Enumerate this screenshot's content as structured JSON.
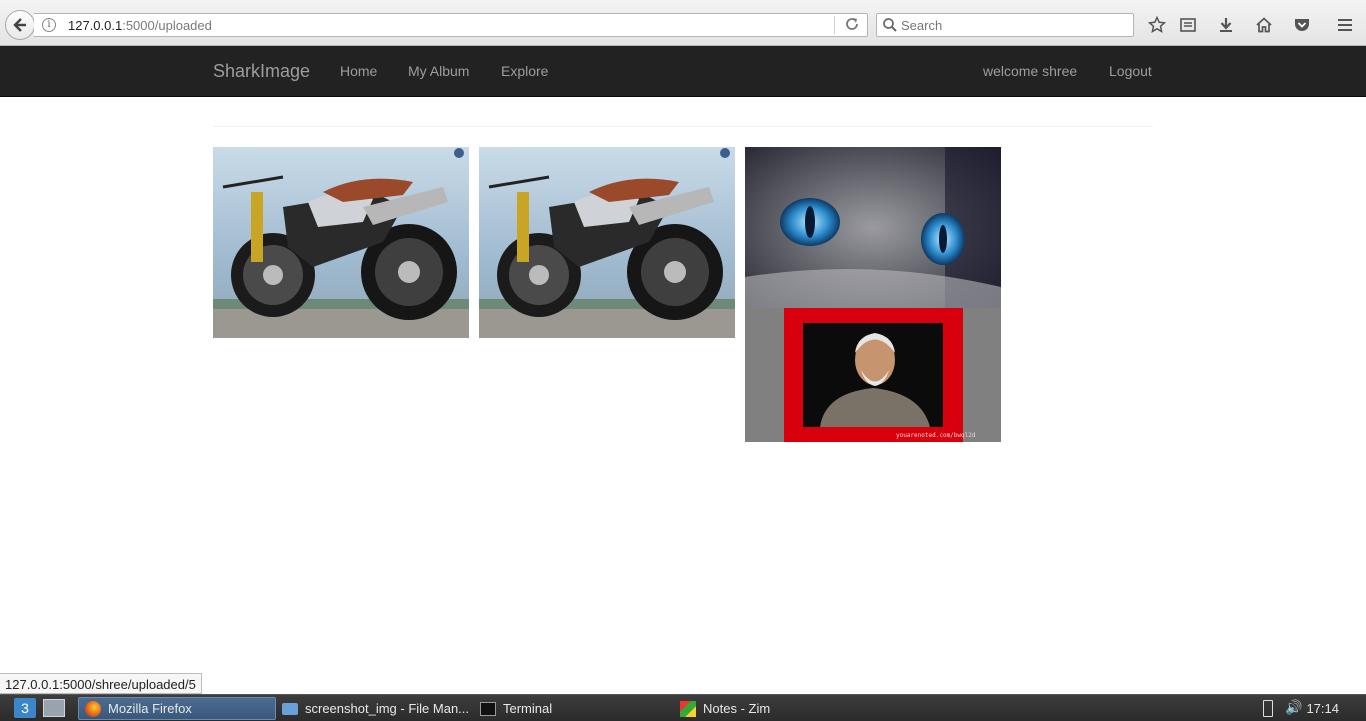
{
  "browser": {
    "url_host": "127.0.0.1",
    "url_path": ":5000/uploaded",
    "search_placeholder": "Search",
    "status_url": "127.0.0.1:5000/shree/uploaded/5"
  },
  "navbar": {
    "brand": "SharkImage",
    "links": [
      "Home",
      "My Album",
      "Explore"
    ],
    "welcome": "welcome shree",
    "logout": "Logout"
  },
  "gallery": {
    "images": [
      {
        "name": "motorcycle-photo-1"
      },
      {
        "name": "motorcycle-photo-2"
      },
      {
        "name": "cat-eyes-photo"
      },
      {
        "name": "portrait-photo",
        "caption": "youarenoted.com/bwql2d"
      }
    ]
  },
  "taskbar": {
    "tasks": [
      "Mozilla Firefox",
      "screenshot_img - File Man...",
      "Terminal",
      "Notes - Zim"
    ],
    "clock": "17:14"
  },
  "colors": {
    "navbar_bg": "#222222",
    "nav_text": "#9d9d9d",
    "portrait_frame": "#d9000d"
  }
}
